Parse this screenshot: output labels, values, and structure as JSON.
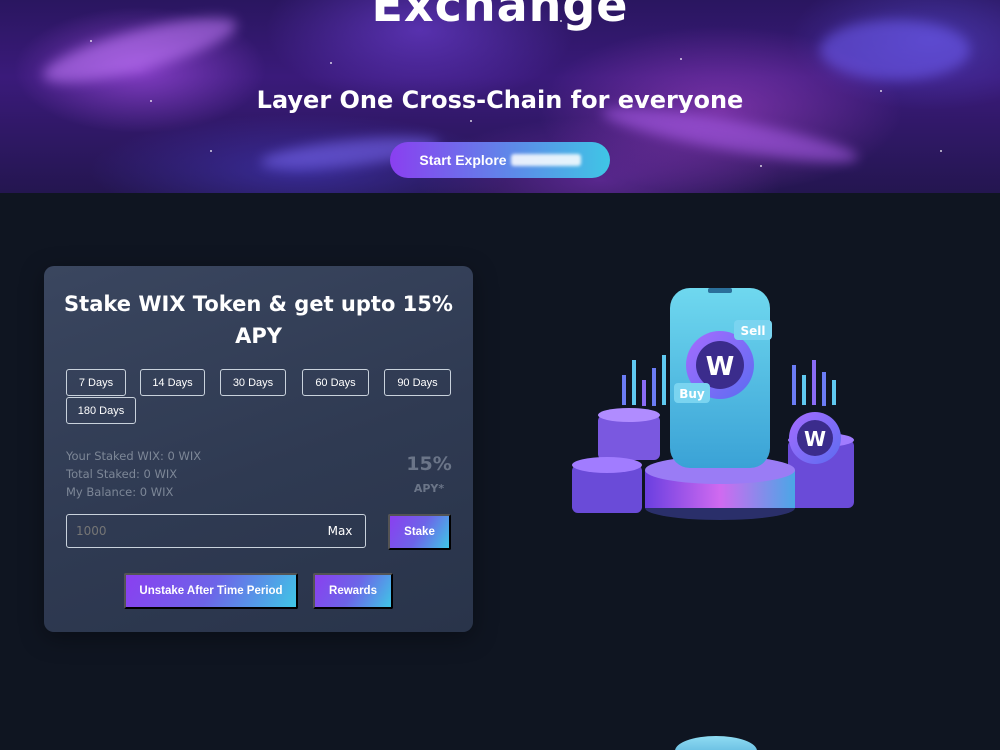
{
  "hero": {
    "title": "Exchange",
    "subtitle": "Layer One Cross-Chain for everyone",
    "explore_label": "Start Explore"
  },
  "stake": {
    "title": "Stake WIX Token & get upto 15% APY",
    "durations": [
      "7 Days",
      "14 Days",
      "30 Days",
      "60 Days",
      "90 Days",
      "180 Days"
    ],
    "selected_duration": "7 Days",
    "stats": {
      "your_staked": "Your Staked WIX: 0 WIX",
      "total_staked": "Total Staked: 0 WIX",
      "my_balance": "My Balance: 0 WIX"
    },
    "apy_value": "15%",
    "apy_label": "APY*",
    "amount_placeholder": "1000",
    "max_label": "Max",
    "stake_label": "Stake",
    "unstake_label": "Unstake After Time Period",
    "rewards_label": "Rewards"
  },
  "illustration": {
    "sell_tag": "Sell",
    "buy_tag": "Buy"
  },
  "colors": {
    "page_bg": "#0f1521",
    "card_bg": "#334058",
    "accent_purple": "#8a3ff0",
    "accent_cyan": "#3fc6e6"
  },
  "icons": {
    "logo_coin": "wix-logo-icon",
    "coin_stack": "coin-stack-icon"
  }
}
